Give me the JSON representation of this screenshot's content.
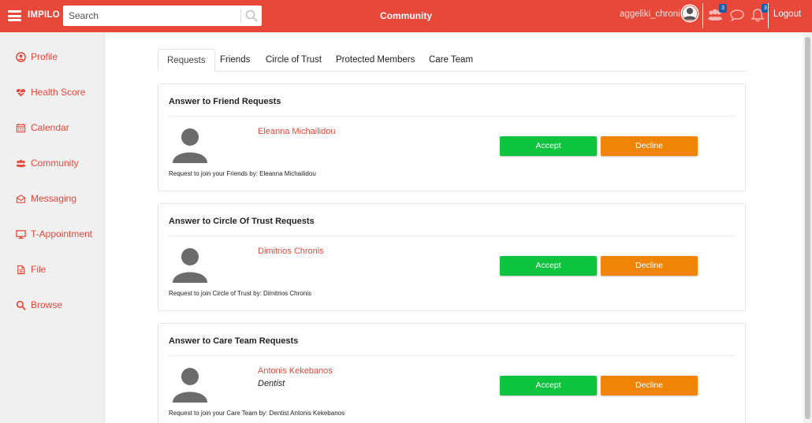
{
  "app": {
    "brand": "IMPILO",
    "page_title": "Community"
  },
  "search": {
    "placeholder": "Search"
  },
  "user": {
    "name": "aggeliki_chroni"
  },
  "header": {
    "friends_badge": "3",
    "notifications_badge": "3",
    "logout_label": "Logout"
  },
  "colors": {
    "accent": "#e8483a",
    "accept": "#0ec33e",
    "decline": "#f08407",
    "badge": "#1e5ba8"
  },
  "sidebar": {
    "items": [
      {
        "label": "Profile",
        "icon": "user-circle-icon"
      },
      {
        "label": "Health Score",
        "icon": "heartbeat-icon"
      },
      {
        "label": "Calendar",
        "icon": "calendar-icon"
      },
      {
        "label": "Community",
        "icon": "users-icon"
      },
      {
        "label": "Messaging",
        "icon": "envelope-icon"
      },
      {
        "label": "T-Appointment",
        "icon": "monitor-icon"
      },
      {
        "label": "File",
        "icon": "file-icon"
      },
      {
        "label": "Browse",
        "icon": "search-icon"
      }
    ]
  },
  "tabs": [
    {
      "label": "Requests",
      "active": true
    },
    {
      "label": "Friends",
      "active": false
    },
    {
      "label": "Circle of Trust",
      "active": false
    },
    {
      "label": "Protected Members",
      "active": false
    },
    {
      "label": "Care Team",
      "active": false
    }
  ],
  "cards": [
    {
      "title": "Answer to Friend Requests",
      "person": "Eleanna Michailidou",
      "role": "",
      "accept_label": "Accept",
      "decline_label": "Decline",
      "note": "Request to join your Friends by: Eleanna Michailidou"
    },
    {
      "title": "Answer to Circle Of Trust Requests",
      "person": "Dimitrios Chronis",
      "role": "",
      "accept_label": "Accept",
      "decline_label": "Decline",
      "note": "Request to join Circle of Trust by: Dimitrios Chronis"
    },
    {
      "title": "Answer to Care Team Requests",
      "person": "Antonis Kekebanos",
      "role": "Dentist",
      "accept_label": "Accept",
      "decline_label": "Decline",
      "note": "Request to join your Care Team by: Dentist Antonis Kekebanos"
    }
  ]
}
